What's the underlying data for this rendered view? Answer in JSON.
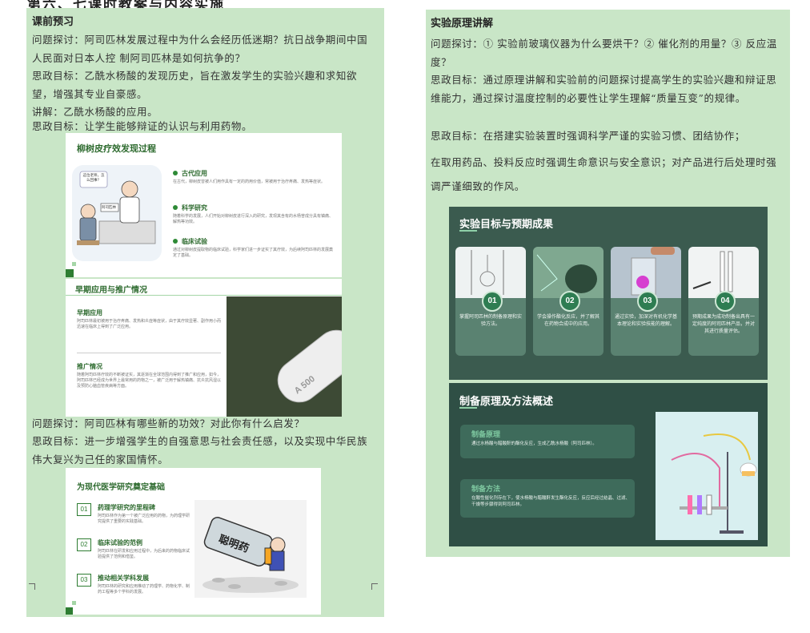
{
  "top_partial_title": "第六、七课时教案与内容实施",
  "left": {
    "section_title": "课前预习",
    "p1": "问题探讨：阿司匹林发展过程中为什么会经历低迷期？抗日战争期间中国人民面对日本人控 制阿司匹林是如何抗争的？",
    "p2": "思政目标：乙酰水杨酸的发现历史，旨在激发学生的实验兴趣和求知欲望，增强其专业自豪感。",
    "p3": "讲解：乙酰水杨酸的应用。",
    "p4": "思政目标：让学生能够辩证的认识与利用药物。",
    "p5": "问题探讨：阿司匹林有哪些新的功效？对此你有什么启发？",
    "p6": "思政目标：进一步增强学生的自强意思与社会责任感，以及实现中华民族伟大复兴为己任的家国情怀。"
  },
  "slide1": {
    "title": "柳树皮疗效发现过程",
    "bubble": "这位老师，怎么回事？",
    "sign": "阿司匹林",
    "items": [
      {
        "head": "古代应用",
        "body": "在古代，柳树皮曾被人们用作具有一定的药用价值，常被用于治疗疼痛、发热等症状。"
      },
      {
        "head": "科学研究",
        "body": "随着科学的发展，人们开始对柳树皮进行深入的研究，发现其含有的水杨苷成分具有镇痛、解热等功效。"
      },
      {
        "head": "临床试验",
        "body": "通过对柳树皮提取物的临床试验，科学家们进一步证实了其疗效，为后续阿司匹林的发展奠定了基础。"
      }
    ]
  },
  "slide2": {
    "title": "早期应用与推广情况",
    "items": [
      {
        "head": "早期应用",
        "body": "阿司匹林最初被用于治疗疼痛、发热和炎症等症状，由于其疗效显著、副作用小而迅速在临床上得到了广泛应用。"
      },
      {
        "head": "推广情况",
        "body": "随着阿司匹林疗效的不断被证实，其逐渐在全球范围内得到了推广和应用，如今，阿司匹林已经成为世界上最常用的药物之一，被广泛用于解热镇痛、抗炎抗风湿以及预防心脑血管疾病等方面。"
      }
    ],
    "pill_text": "A 500"
  },
  "slide3": {
    "title": "为现代医学研究奠定基础",
    "items": [
      {
        "num": "01",
        "head": "药理学研究的里程碑",
        "body": "阿司匹林作为第一个被广泛应用的药物，为药理学研究提供了重要的实践基础。"
      },
      {
        "num": "02",
        "head": "临床试验的范例",
        "body": "阿司匹林在研发和应用过程中，为后来的药物临床试验提供了范例和借鉴。"
      },
      {
        "num": "03",
        "head": "推动相关学科发展",
        "body": "阿司匹林的研究和应用推动了药理学、药物化学、制药工程等多个学科的发展。"
      }
    ],
    "bottle_label": "聪明药"
  },
  "right": {
    "section_title": "实验原理讲解",
    "p1": "问题探讨：① 实验前玻璃仪器为什么要烘干？② 催化剂的用量？③ 反应温度？",
    "p2": "思政目标：通过原理讲解和实验前的问题探讨提高学生的实验兴趣和辩证思维能力，通过探讨温度控制的必要性让学生理解“质量互变”的规律。",
    "p3": "思政目标：在搭建实验装置时强调科学严谨的实验习惯、团结协作；",
    "p4": "在取用药品、投料反应时强调生命意识与安全意识；对产品进行后处理时强调严谨细致的作风。"
  },
  "slide4": {
    "title": "实验目标与预期成果",
    "cards": [
      {
        "num": "01",
        "text": "掌握阿司匹林的制备原理和实验方法。"
      },
      {
        "num": "02",
        "text": "学会操作酯化反应，并了解其在药物合成中的应用。"
      },
      {
        "num": "03",
        "text": "通过实验，加深对有机化学基本理论和实验技能的理解。"
      },
      {
        "num": "04",
        "text": "预期成果为成功制备出具有一定纯度的阿司匹林产品，并对其进行质量评估。"
      }
    ]
  },
  "slide5": {
    "title": "制备原理及方法概述",
    "boxes": [
      {
        "head": "制备原理",
        "body": "通过水杨酸与醋酸酐的酯化反应，生成乙酰水杨酸（阿司匹林）。"
      },
      {
        "head": "制备方法",
        "body": "在酸性催化剂存在下，使水杨酸与醋酸酐发生酯化反应，反应后经过结晶、过滤、干燥等步骤得到阿司匹林。"
      }
    ]
  },
  "colors": {
    "panel": "#c9e6c7",
    "accent_green": "#2e7d32",
    "chalkboard": "#2f4f45"
  }
}
